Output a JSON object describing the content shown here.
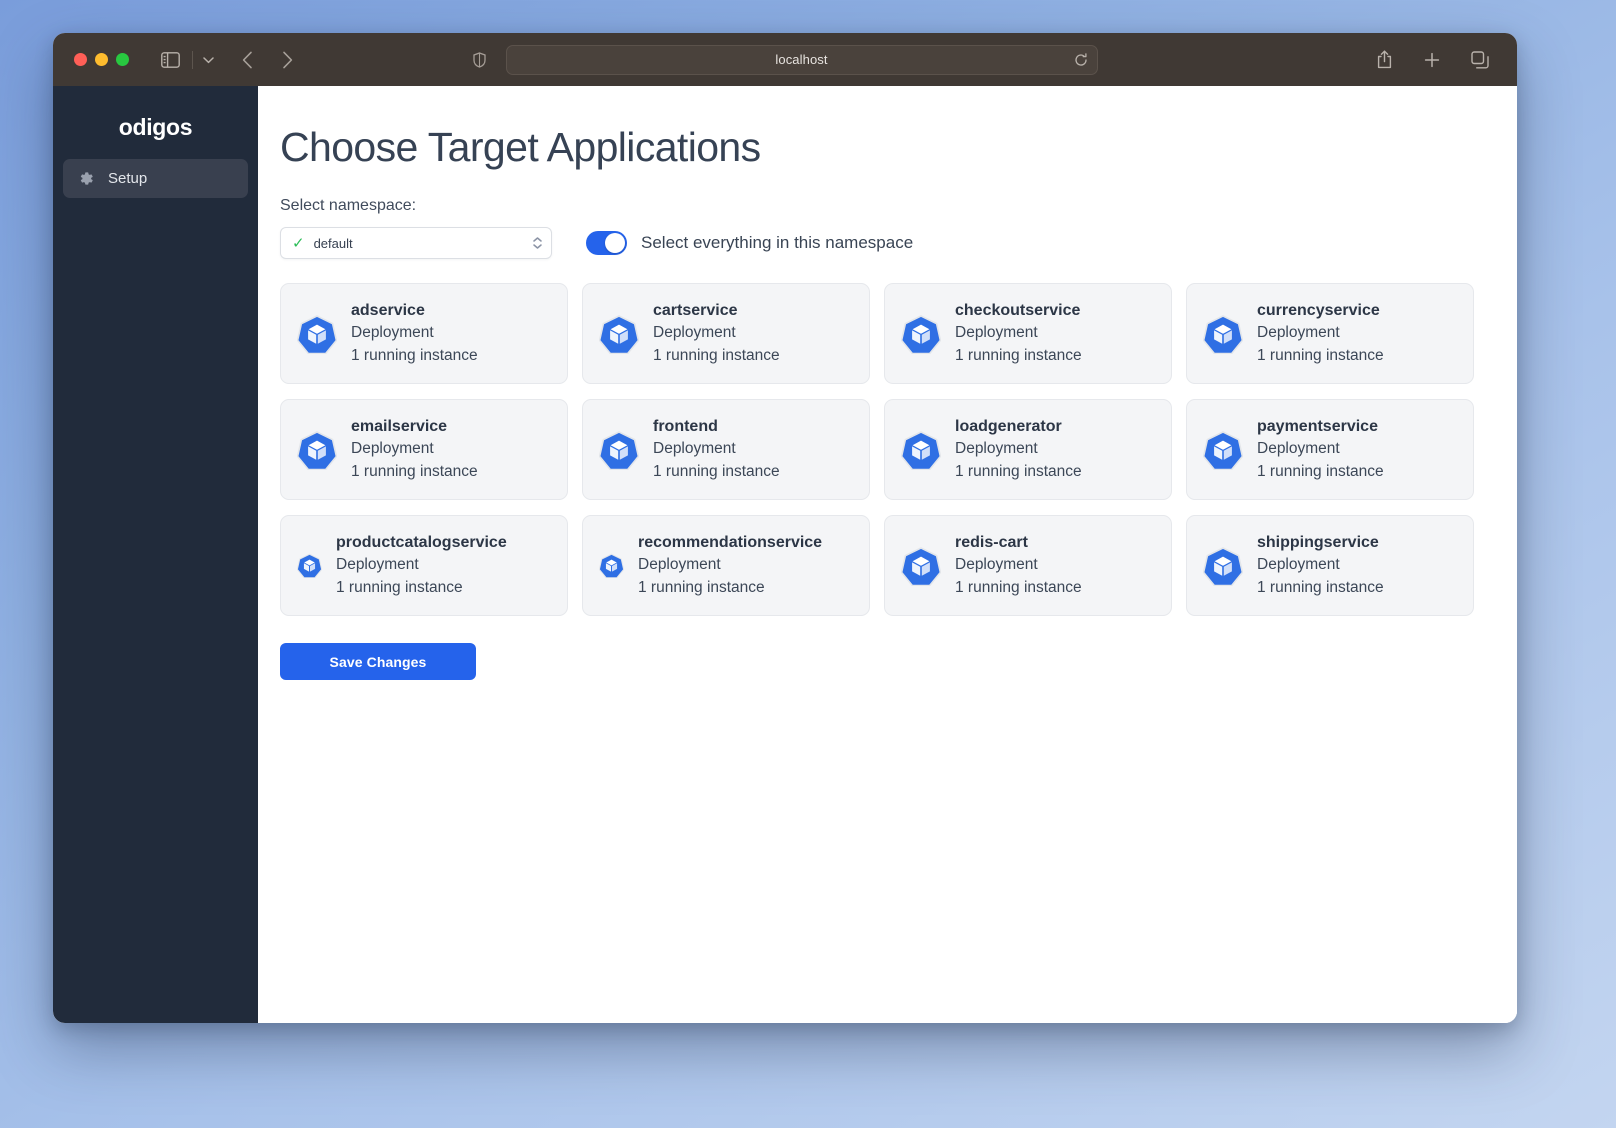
{
  "browser": {
    "url": "localhost",
    "icons": {
      "sidebar_toggle": "sidebar-toggle-icon",
      "tab_overview_chevron": "chevron-down-icon",
      "back": "chevron-left-icon",
      "forward": "chevron-right-icon",
      "shield": "shield-icon",
      "reload": "reload-icon",
      "share": "share-icon",
      "new_tab": "plus-icon",
      "tab_overview": "tabs-icon"
    }
  },
  "sidebar": {
    "brand": "odigos",
    "items": [
      {
        "label": "Setup",
        "icon": "gear-icon",
        "active": true
      }
    ]
  },
  "main": {
    "title": "Choose Target Applications",
    "namespace_label": "Select namespace:",
    "namespace_select": {
      "value": "default",
      "checked": true,
      "options": [
        "default"
      ]
    },
    "select_all_toggle": {
      "label": "Select everything in this namespace",
      "on": true,
      "color": "#2563eb"
    },
    "save_button": {
      "label": "Save Changes",
      "color": "#2563eb"
    },
    "card_kind_label": "Deployment",
    "applications": [
      {
        "name": "adservice",
        "kind": "Deployment",
        "instances": "1 running instance",
        "icon": "kubernetes-icon"
      },
      {
        "name": "cartservice",
        "kind": "Deployment",
        "instances": "1 running instance",
        "icon": "kubernetes-icon"
      },
      {
        "name": "checkoutservice",
        "kind": "Deployment",
        "instances": "1 running instance",
        "icon": "kubernetes-icon"
      },
      {
        "name": "currencyservice",
        "kind": "Deployment",
        "instances": "1 running instance",
        "icon": "kubernetes-icon"
      },
      {
        "name": "emailservice",
        "kind": "Deployment",
        "instances": "1 running instance",
        "icon": "kubernetes-icon"
      },
      {
        "name": "frontend",
        "kind": "Deployment",
        "instances": "1 running instance",
        "icon": "kubernetes-icon"
      },
      {
        "name": "loadgenerator",
        "kind": "Deployment",
        "instances": "1 running instance",
        "icon": "kubernetes-icon"
      },
      {
        "name": "paymentservice",
        "kind": "Deployment",
        "instances": "1 running instance",
        "icon": "kubernetes-icon"
      },
      {
        "name": "productcatalogservice",
        "kind": "Deployment",
        "instances": "1 running instance",
        "icon": "kubernetes-icon"
      },
      {
        "name": "recommendationservice",
        "kind": "Deployment",
        "instances": "1 running instance",
        "icon": "kubernetes-icon"
      },
      {
        "name": "redis-cart",
        "kind": "Deployment",
        "instances": "1 running instance",
        "icon": "kubernetes-icon"
      },
      {
        "name": "shippingservice",
        "kind": "Deployment",
        "instances": "1 running instance",
        "icon": "kubernetes-icon"
      }
    ]
  }
}
